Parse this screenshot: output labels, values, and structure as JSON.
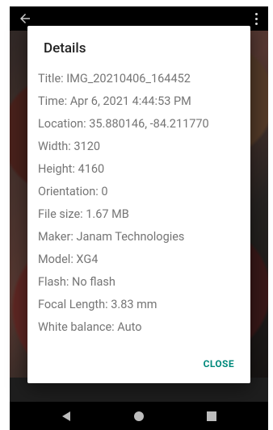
{
  "dialog": {
    "title": "Details",
    "rows": [
      "Title: IMG_20210406_164452",
      "Time: Apr 6, 2021 4:44:53 PM",
      "Location: 35.880146, -84.211770",
      "Width: 3120",
      "Height: 4160",
      "Orientation: 0",
      "File size: 1.67 MB",
      "Maker: Janam Technologies",
      "Model: XG4",
      "Flash: No flash",
      "Focal Length: 3.83 mm",
      "White balance: Auto"
    ],
    "close_label": "CLOSE"
  },
  "colors": {
    "accent": "#00897b",
    "row_text": "#757575",
    "title_text": "#212121"
  },
  "icons": {
    "back": "back-arrow-icon",
    "more": "more-vert-icon",
    "nav_back": "nav-back-icon",
    "nav_home": "nav-home-icon",
    "nav_recents": "nav-recents-icon"
  }
}
